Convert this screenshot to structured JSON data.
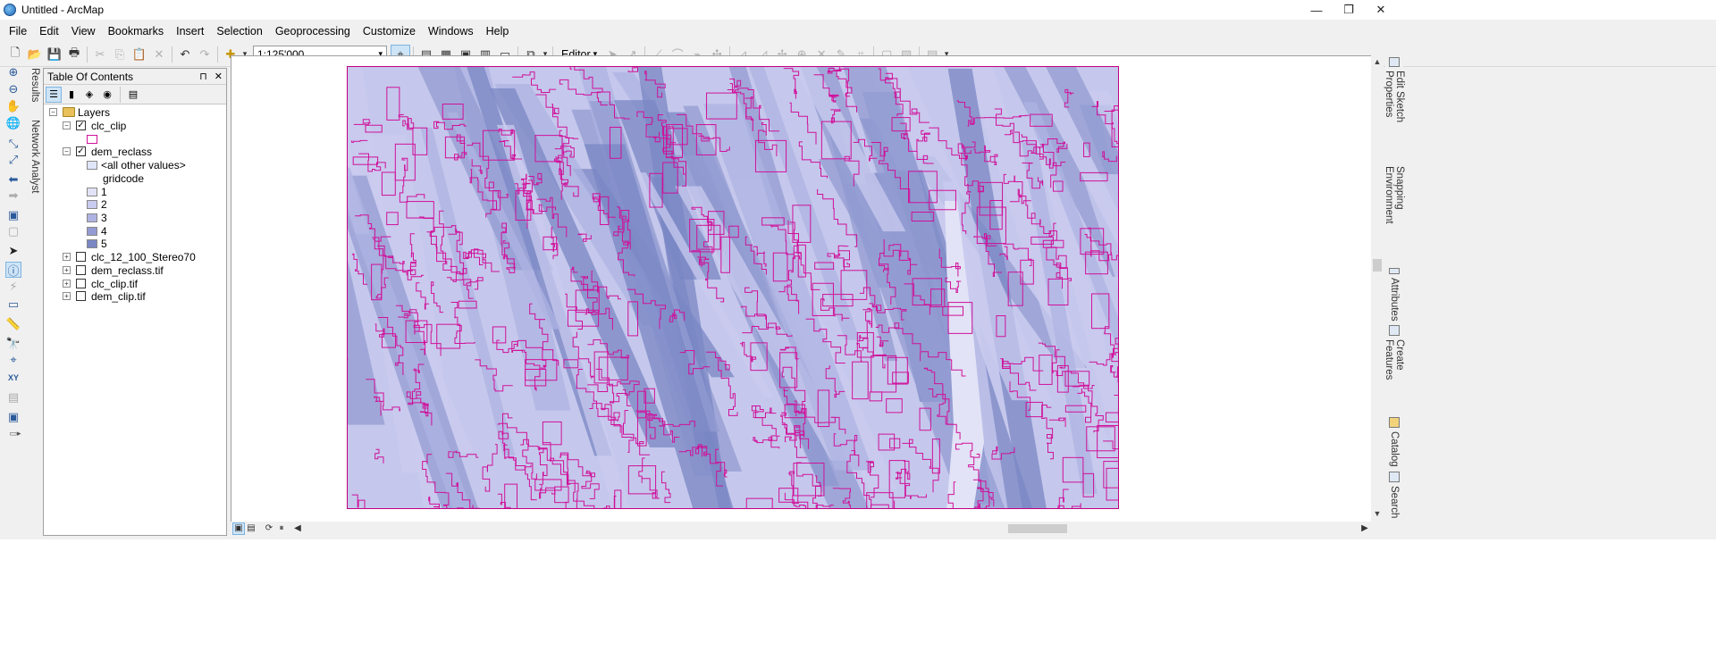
{
  "window": {
    "title": "Untitled - ArcMap",
    "controls": {
      "minimize": "—",
      "maximize": "❐",
      "close": "✕"
    }
  },
  "menu": [
    "File",
    "Edit",
    "View",
    "Bookmarks",
    "Insert",
    "Selection",
    "Geoprocessing",
    "Customize",
    "Windows",
    "Help"
  ],
  "toolbar": {
    "scale": "1:125'000",
    "editor_label": "Editor",
    "dropdown": "▾"
  },
  "left_tabs": {
    "results": "Results",
    "network_analyst": "Network Analyst"
  },
  "toc": {
    "title": "Table Of Contents",
    "pin": "⊓",
    "close": "✕",
    "root": "Layers",
    "layers": [
      {
        "name": "clc_clip",
        "checked": true,
        "expanded": true
      },
      {
        "name": "dem_reclass",
        "checked": true,
        "expanded": true
      },
      {
        "name": "clc_12_100_Stereo70",
        "checked": false,
        "expanded": false
      },
      {
        "name": "dem_reclass.tif",
        "checked": false,
        "expanded": false
      },
      {
        "name": "clc_clip.tif",
        "checked": false,
        "expanded": false
      },
      {
        "name": "dem_clip.tif",
        "checked": false,
        "expanded": false
      }
    ],
    "dem_legend": {
      "other_values": "<all other values>",
      "field": "gridcode",
      "classes": [
        {
          "label": "1",
          "color": "#e2e3f6"
        },
        {
          "label": "2",
          "color": "#c9cbef"
        },
        {
          "label": "3",
          "color": "#aeb3e2"
        },
        {
          "label": "4",
          "color": "#939cd2"
        },
        {
          "label": "5",
          "color": "#7a87c4"
        }
      ]
    },
    "expand_sym": "+",
    "collapse_sym": "−",
    "check_sym": "✓"
  },
  "right_tabs": {
    "edit_sketch": "Edit Sketch Properties",
    "snapping": "Snapping Environment",
    "attributes": "Attributes",
    "create_features": "Create Features",
    "catalog": "Catalog",
    "search": "Search"
  },
  "colors": {
    "polygon_outline": "#d0109a",
    "map_base": "#c5c8ec",
    "other_values_swatch": "#dfe6fa"
  },
  "icons": {
    "new": "🗋",
    "open": "📂",
    "save": "💾",
    "print": "🖶",
    "cut": "✂",
    "copy": "⎘",
    "paste": "📋",
    "delete": "✕",
    "undo": "↶",
    "redo": "↷",
    "add_data": "✚",
    "editor_tool": "⌖",
    "zoom_in": "⊕",
    "zoom_out": "⊖",
    "pan": "✋",
    "globe": "🌐",
    "full_extent": "⤢",
    "back": "⬅",
    "forward": "➡",
    "select": "➤",
    "identify": "ⓘ",
    "find": "🔭",
    "xy": "XY",
    "measure": "📏",
    "hyperlink": "⚡"
  }
}
